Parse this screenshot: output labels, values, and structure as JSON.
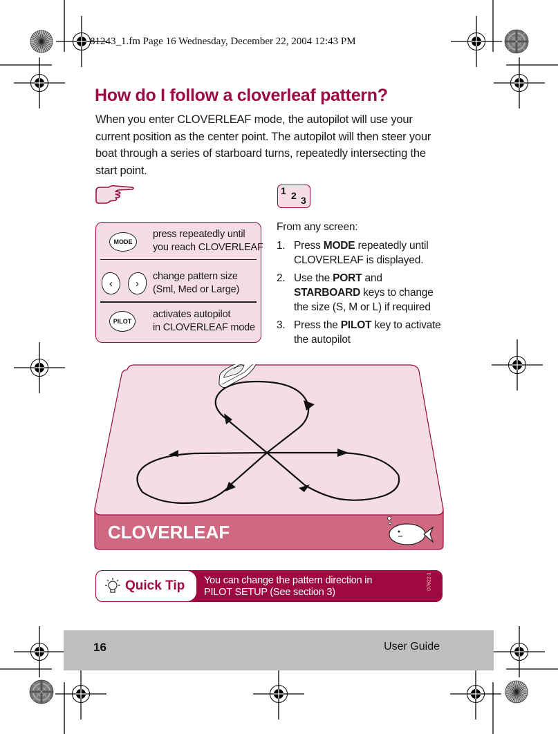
{
  "print_slug": "81243_1.fm  Page 16  Wednesday, December 22, 2004  12:43 PM",
  "title": "How do I follow a cloverleaf pattern?",
  "intro": "When you enter CLOVERLEAF mode, the autopilot will use your current position as the center point. The autopilot will then steer your boat through a series of starboard turns, repeatedly intersecting the start point.",
  "icons": {
    "hand": "pointing-hand-icon",
    "steps": "numbered-steps-icon",
    "steps_digits": [
      "1",
      "2",
      "3"
    ]
  },
  "key_panel": {
    "rows": [
      {
        "keys": [
          "MODE"
        ],
        "description_lines": [
          "press repeatedly until",
          "you reach CLOVERLEAF"
        ]
      },
      {
        "keys": [
          "‹",
          "›"
        ],
        "key_names": [
          "PORT",
          "STARBOARD"
        ],
        "description_lines": [
          "change pattern size",
          "(Sml, Med or Large)"
        ]
      },
      {
        "keys": [
          "PILOT"
        ],
        "description_lines": [
          "activates autopilot",
          "in CLOVERLEAF mode"
        ]
      }
    ]
  },
  "steps": {
    "lead": "From any screen:",
    "items": [
      {
        "num": "1.",
        "pre": "Press ",
        "bold": "MODE",
        "post": " repeatedly until CLOVERLEAF is displayed."
      },
      {
        "num": "2.",
        "pre": "Use the ",
        "bold": "PORT",
        "mid": " and ",
        "bold2": "STARBOARD",
        "post": " keys to change the size (S, M or L) if required"
      },
      {
        "num": "3.",
        "pre": "Press the ",
        "bold": "PILOT",
        "post": " key to activate the autopilot"
      }
    ]
  },
  "diagram": {
    "label": "CLOVERLEAF",
    "pattern": "cloverleaf",
    "boat_icon": "boat-icon",
    "fish_icon": "fish-icon"
  },
  "quick_tip": {
    "label": "Quick Tip",
    "text_lines": [
      "You can change the pattern direction in",
      "PILOT SETUP (See section 3)"
    ],
    "code": "D7622-1"
  },
  "footer": {
    "page_number": "16",
    "guide_label": "User Guide"
  },
  "colors": {
    "brand": "#9b0a42",
    "panel_bg": "#f4dde3",
    "diagram_side": "#d06882",
    "footer_bg": "#bebebe"
  }
}
